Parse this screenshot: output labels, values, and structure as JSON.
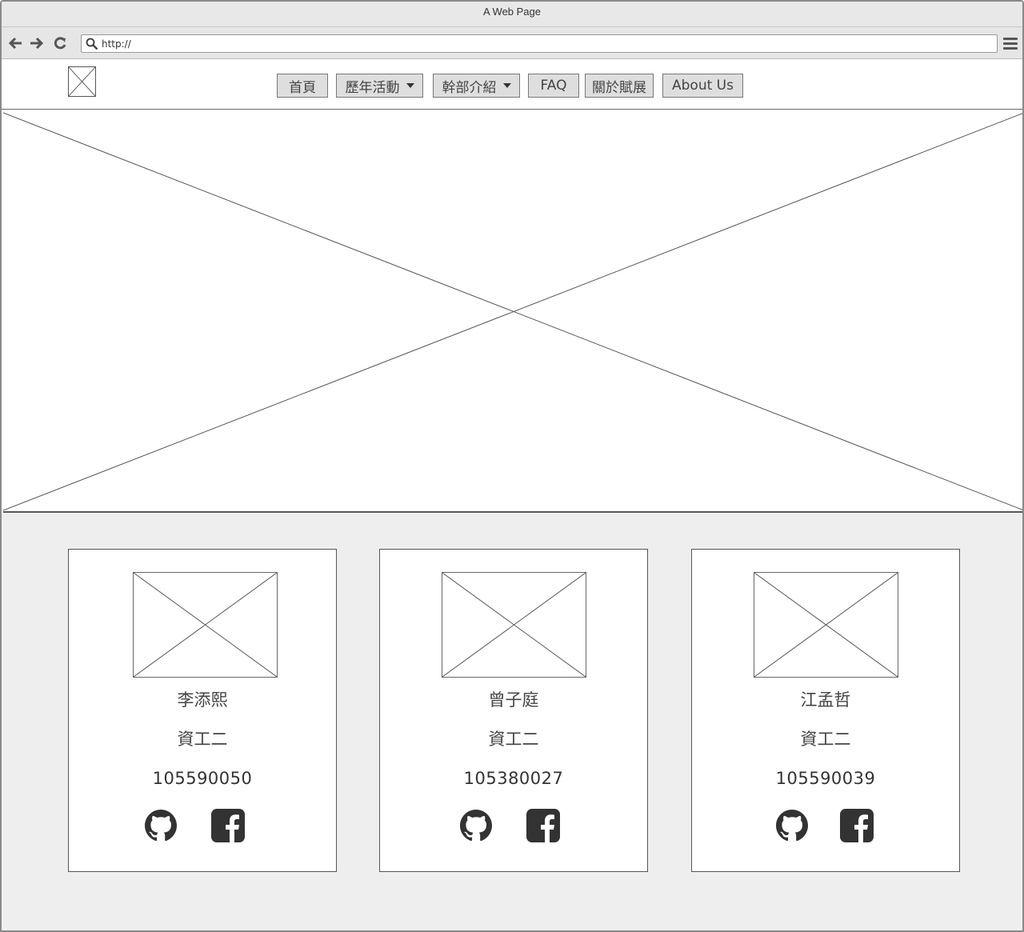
{
  "browser": {
    "title": "A Web Page",
    "url": "http://"
  },
  "nav": {
    "items": [
      {
        "label": "首頁"
      },
      {
        "label": "歷年活動"
      },
      {
        "label": "幹部介紹"
      },
      {
        "label": "FAQ"
      },
      {
        "label": "關於賦展"
      },
      {
        "label": "About Us"
      }
    ]
  },
  "members": [
    {
      "name": "李添熙",
      "dept": "資工二",
      "student_id": "105590050"
    },
    {
      "name": "曾子庭",
      "dept": "資工二",
      "student_id": "105380027"
    },
    {
      "name": "江孟哲",
      "dept": "資工二",
      "student_id": "105590039"
    }
  ],
  "icons": {
    "github": "github-icon",
    "facebook": "facebook-icon"
  },
  "colors": {
    "section_bg": "#eeeeee",
    "button_bg": "#dedede",
    "accent_strip": "#3fd4d4"
  }
}
